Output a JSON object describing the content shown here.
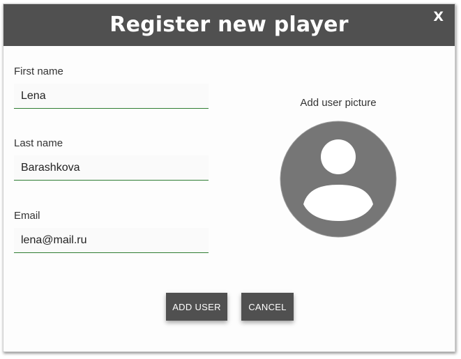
{
  "dialog": {
    "title": "Register new player",
    "close_label": "X"
  },
  "form": {
    "first_name": {
      "label": "First name",
      "value": "Lena"
    },
    "last_name": {
      "label": "Last name",
      "value": "Barashkova"
    },
    "email": {
      "label": "Email",
      "value": "lena@mail.ru"
    }
  },
  "picture": {
    "label": "Add user picture",
    "icon": "user-avatar-placeholder-icon"
  },
  "actions": {
    "add_user_label": "ADD USER",
    "cancel_label": "CANCEL"
  },
  "colors": {
    "header_bg": "#505050",
    "input_underline": "#2e7d32",
    "avatar_gray": "#767676",
    "button_bg": "#505050"
  }
}
